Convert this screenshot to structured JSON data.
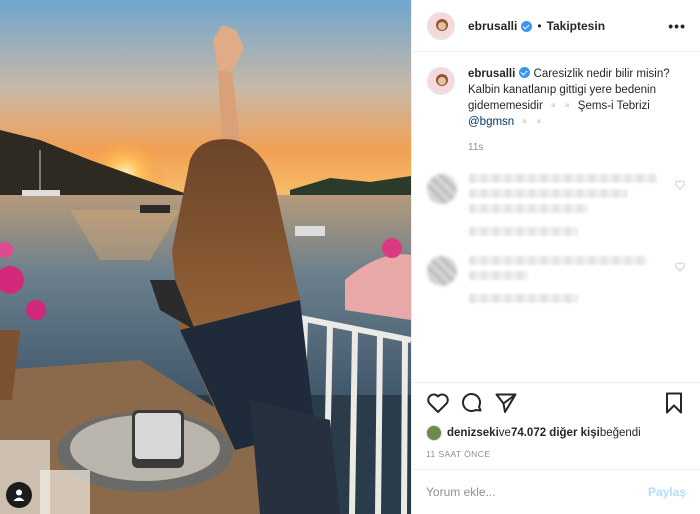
{
  "header": {
    "username": "ebrusalli",
    "separator": "•",
    "follow_status": "Takiptesin",
    "more": "•••"
  },
  "caption": {
    "username": "ebrusalli",
    "text": "Caresizlik nedir bilir misin? Kalbin kanatlanıp gittigi yere bedenin gidememesidir ▫️▫️ Şems-i Tebrizi",
    "mention": "@bgmsn",
    "mention_suffix": " ▫️▫️",
    "age": "11s"
  },
  "actions": {
    "icons": [
      "heart-icon",
      "comment-icon",
      "share-icon",
      "bookmark-icon"
    ]
  },
  "likes": {
    "first_liker": "denizseki",
    "connector": " ve ",
    "count": "74.072 diğer kişi",
    "suffix": " beğendi"
  },
  "timestamp": "11 SAAT ÖNCE",
  "comment_input": {
    "placeholder": "Yorum ekle...",
    "submit_label": "Paylaş"
  },
  "colors": {
    "verified": "#3897f0",
    "mention": "#00376b",
    "share_disabled": "#b2dffc"
  }
}
